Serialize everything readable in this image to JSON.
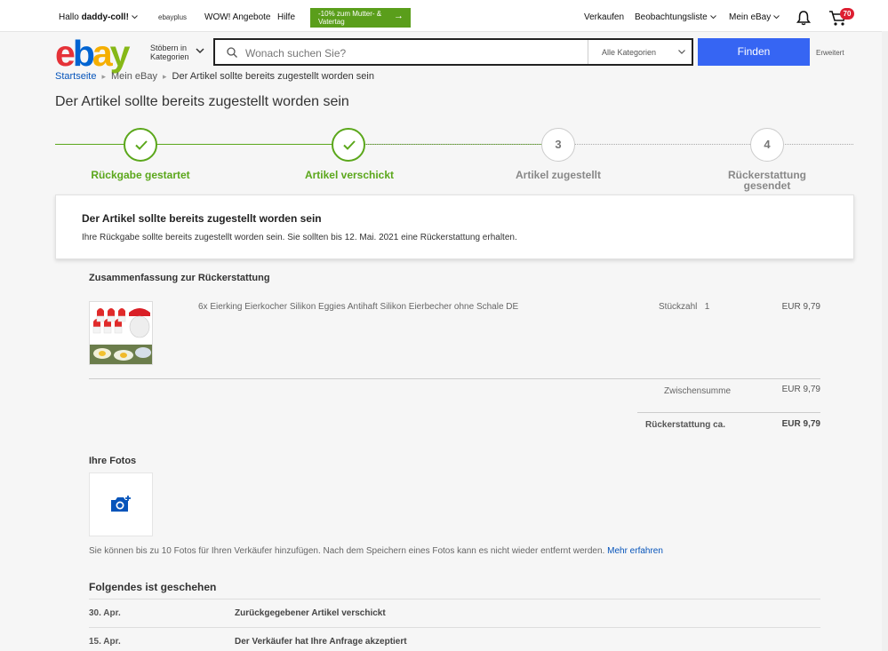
{
  "topbar": {
    "greeting_prefix": "Hallo",
    "username": "daddy-coll!",
    "ebayplus": "ebayplus",
    "wow": "WOW! Angebote",
    "help": "Hilfe",
    "promo": "-10% zum Mutter- & Vatertag",
    "sell": "Verkaufen",
    "watchlist": "Beobachtungsliste",
    "my_ebay": "Mein eBay",
    "cart_count": "70"
  },
  "header": {
    "logo": [
      "e",
      "b",
      "a",
      "y"
    ],
    "browse_label": "Stöbern in Kategorien",
    "search_placeholder": "Wonach suchen Sie?",
    "category": "Alle Kategorien",
    "find_button": "Finden",
    "advanced": "Erweitert"
  },
  "breadcrumb": {
    "home": "Startseite",
    "my_ebay": "Mein eBay",
    "current": "Der Artikel sollte bereits zugestellt worden sein"
  },
  "page_title": "Der Artikel sollte bereits zugestellt worden sein",
  "steps": [
    {
      "label": "Rückgabe gestartet",
      "status": "done",
      "number": ""
    },
    {
      "label": "Artikel verschickt",
      "status": "done",
      "number": ""
    },
    {
      "label": "Artikel zugestellt",
      "status": "todo",
      "number": "3"
    },
    {
      "label": "Rückerstattung gesendet",
      "status": "todo",
      "number": "4"
    }
  ],
  "info_card": {
    "title": "Der Artikel sollte bereits zugestellt worden sein",
    "text": "Ihre Rückgabe sollte bereits zugestellt worden sein. Sie sollten bis 12. Mai. 2021 eine Rückerstattung erhalten."
  },
  "summary": {
    "title": "Zusammenfassung zur Rückerstattung",
    "item_title": "6x Eierking Eierkocher Silikon Eggies Antihaft Silikon Eierbecher ohne Schale DE",
    "qty_label": "Stückzahl",
    "qty": "1",
    "item_price": "EUR 9,79",
    "subtotal_label": "Zwischensumme",
    "subtotal": "EUR 9,79",
    "refund_label": "Rückerstattung ca.",
    "refund": "EUR 9,79"
  },
  "photos": {
    "title": "Ihre Fotos",
    "note": "Sie können bis zu 10 Fotos für Ihren Verkäufer hinzufügen. Nach dem Speichern eines Fotos kann es nicht wieder entfernt werden.",
    "learn_more": "Mehr erfahren"
  },
  "history": {
    "title": "Folgendes ist geschehen",
    "rows": [
      {
        "date": "30. Apr.",
        "event": "Zurückgegebener Artikel verschickt"
      },
      {
        "date": "15. Apr.",
        "event": "Der Verkäufer hat Ihre Anfrage akzeptiert"
      }
    ]
  },
  "colors": {
    "green": "#5ba71b",
    "blue_button": "#3665f3",
    "link": "#0654ba",
    "badge": "#dd1e31"
  }
}
